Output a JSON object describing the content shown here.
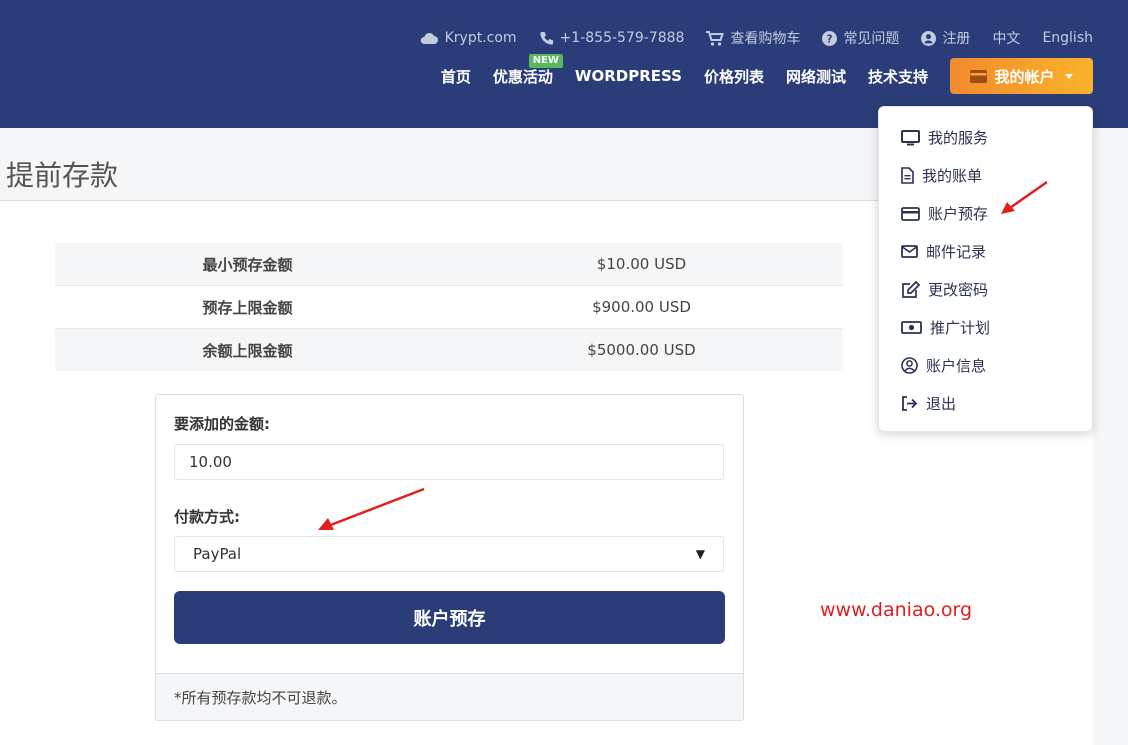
{
  "header": {
    "top_links": [
      {
        "label": "Krypt.com",
        "icon": "cloud-icon"
      },
      {
        "label": "+1-855-579-7888",
        "icon": "phone-icon"
      },
      {
        "label": "查看购物车",
        "icon": "cart-icon"
      },
      {
        "label": "常见问题",
        "icon": "question-circle-icon"
      },
      {
        "label": "注册",
        "icon": "user-circle-icon"
      },
      {
        "label": "中文",
        "icon": ""
      },
      {
        "label": "English",
        "icon": ""
      }
    ],
    "nav": [
      {
        "label": "首页"
      },
      {
        "label": "优惠活动",
        "badge": "NEW"
      },
      {
        "label": "WORDPRESS"
      },
      {
        "label": "价格列表"
      },
      {
        "label": "网络测试"
      },
      {
        "label": "技术支持"
      }
    ],
    "account_button": "我的帐户"
  },
  "page": {
    "title": "提前存款"
  },
  "limits": [
    {
      "label": "最小预存金额",
      "value": "$10.00 USD"
    },
    {
      "label": "预存上限金额",
      "value": "$900.00 USD"
    },
    {
      "label": "余额上限金额",
      "value": "$5000.00 USD"
    }
  ],
  "form": {
    "amount_label": "要添加的金额:",
    "amount_value": "10.00",
    "payment_label": "付款方式:",
    "payment_selected": "PayPal",
    "submit_label": "账户预存",
    "footer_note": "*所有预存款均不可退款。"
  },
  "dropdown": {
    "items": [
      {
        "label": "我的服务",
        "icon": "monitor-icon"
      },
      {
        "label": "我的账单",
        "icon": "file-invoice-icon"
      },
      {
        "label": "账户预存",
        "icon": "credit-card-icon"
      },
      {
        "label": "邮件记录",
        "icon": "envelope-icon"
      },
      {
        "label": "更改密码",
        "icon": "edit-icon"
      },
      {
        "label": "推广计划",
        "icon": "money-bill-icon"
      },
      {
        "label": "账户信息",
        "icon": "user-circle-icon"
      },
      {
        "label": "退出",
        "icon": "sign-out-icon"
      }
    ]
  },
  "watermark": "www.daniao.org",
  "colors": {
    "header_bg": "#2b3d78",
    "accent_orange": "#f28a2e",
    "badge_green": "#5cb85c",
    "annotation_red": "#e02020"
  }
}
